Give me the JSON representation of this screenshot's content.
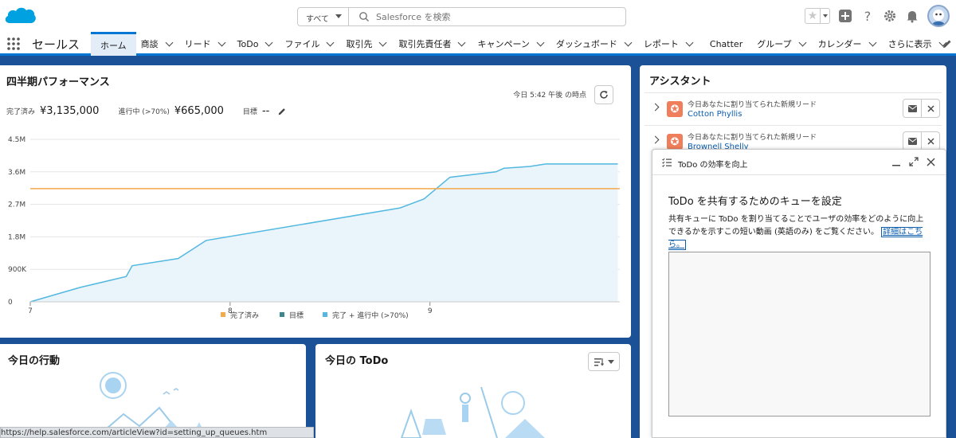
{
  "header": {
    "search_scope": "すべて",
    "search_placeholder": "Salesforce を検索"
  },
  "nav": {
    "app_name": "セールス",
    "tabs": [
      {
        "label": "ホーム",
        "active": true,
        "menu": false
      },
      {
        "label": "商談",
        "active": false,
        "menu": true
      },
      {
        "label": "リード",
        "active": false,
        "menu": true
      },
      {
        "label": "ToDo",
        "active": false,
        "menu": true
      },
      {
        "label": "ファイル",
        "active": false,
        "menu": true
      },
      {
        "label": "取引先",
        "active": false,
        "menu": true
      },
      {
        "label": "取引先責任者",
        "active": false,
        "menu": true
      },
      {
        "label": "キャンペーン",
        "active": false,
        "menu": true
      },
      {
        "label": "ダッシュボード",
        "active": false,
        "menu": true
      },
      {
        "label": "レポート",
        "active": false,
        "menu": true
      },
      {
        "label": "Chatter",
        "active": false,
        "menu": false
      },
      {
        "label": "グループ",
        "active": false,
        "menu": true
      },
      {
        "label": "カレンダー",
        "active": false,
        "menu": true
      },
      {
        "label": "さらに表示",
        "active": false,
        "menu": true
      }
    ]
  },
  "performance": {
    "title": "四半期パフォーマンス",
    "as_of": "今日 5:42 午後 の時点",
    "closed_label": "完了済み",
    "closed_value": "¥3,135,000",
    "open_label": "進行中 (>70%)",
    "open_value": "¥665,000",
    "goal_label": "目標",
    "goal_value": "--"
  },
  "chart_data": {
    "type": "line",
    "y_ticks": [
      "0",
      "900K",
      "1.8M",
      "2.7M",
      "3.6M",
      "4.5M"
    ],
    "y_tick_values": [
      0,
      900000,
      1800000,
      2700000,
      3600000,
      4500000
    ],
    "ylim": [
      0,
      4500000
    ],
    "x_ticks": [
      "7",
      "8",
      "9"
    ],
    "x_tick_values": [
      7,
      8,
      9
    ],
    "xlim": [
      7,
      9.95
    ],
    "grid": true,
    "legend_position": "bottom",
    "legend": [
      {
        "label": "完了済み",
        "color": "#f4a94b"
      },
      {
        "label": "目標",
        "color": "#3b878c"
      },
      {
        "label": "完了 + 進行中 (>70%)",
        "color": "#52b8e0"
      }
    ],
    "series": [
      {
        "name": "完了 + 進行中 (>70%)",
        "color": "#52b8e0",
        "x": [
          7.0,
          7.25,
          7.48,
          7.51,
          7.74,
          7.88,
          8.85,
          8.97,
          9.1,
          9.33,
          9.37,
          9.5,
          9.58,
          9.94
        ],
        "y": [
          0,
          400000,
          700000,
          1000000,
          1200000,
          1700000,
          2600000,
          2850000,
          3450000,
          3600000,
          3700000,
          3750000,
          3820000,
          3820000
        ]
      }
    ],
    "reference_line": {
      "name": "完了済み",
      "value": 3135000,
      "color": "#f4a94b"
    }
  },
  "events": {
    "title": "今日の行動"
  },
  "todo": {
    "title": "今日の ToDo"
  },
  "status_bar": {
    "url": "https://help.salesforce.com/articleView?id=setting_up_queues.htm"
  },
  "assistant": {
    "title": "アシスタント",
    "items": [
      {
        "text": "今日あなたに割り当てられた新規リード",
        "name": "Cotton Phyllis"
      },
      {
        "text": "今日あなたに割り当てられた新規リード",
        "name": "Brownell Shelly"
      }
    ]
  },
  "panel": {
    "title": "ToDo の効率を向上",
    "heading": "ToDo を共有するためのキューを設定",
    "description": "共有キューに ToDo を割り当てることでユーザの効率をどのように向上できるかを示すこの短い動画 (英語のみ) をご覧ください。",
    "link": "詳細はこちら。"
  },
  "colors": {
    "brand": "#0176d3",
    "background": "#1b5297",
    "lead_icon": "#ef7f5c"
  }
}
